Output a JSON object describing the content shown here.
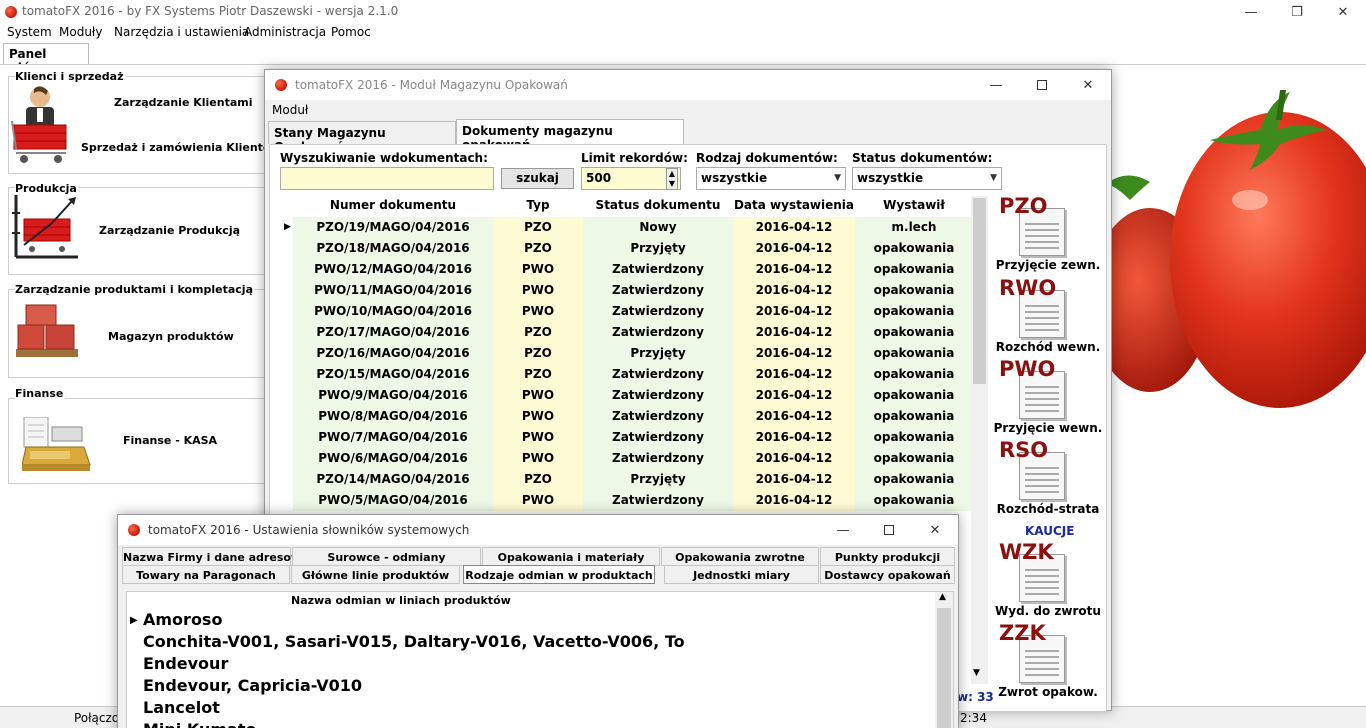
{
  "main_window": {
    "title": "tomatoFX 2016 - by FX Systems Piotr Daszewski - wersja 2.1.0",
    "menu": [
      "System",
      "Moduły",
      "Narzędzia i ustawienia",
      "Administracja",
      "Pomoc"
    ],
    "tab": "Panel główny",
    "controls": {
      "minimize": "—",
      "maximize": "❐",
      "close": "✕"
    }
  },
  "panel": {
    "groups": [
      {
        "label": "Klienci i sprzedaż",
        "links": [
          "Zarządzanie Klientami",
          "Sprzedaż i zamówienia Klientów"
        ]
      },
      {
        "label": "Produkcja",
        "links": [
          "Zarządzanie Produkcją"
        ]
      },
      {
        "label": "Zarządzanie produktami i kompletacją",
        "links": [
          "Magazyn produktów"
        ]
      },
      {
        "label": "Finanse",
        "links": [
          "Finanse - KASA"
        ]
      }
    ]
  },
  "status_bar": {
    "left": "Połączon",
    "right": "2:34"
  },
  "mag_window": {
    "title": "tomatoFX 2016 - Moduł Magazynu Opakowań",
    "menu": "Moduł",
    "tabs": [
      "Stany Magazynu Opakowań",
      "Dokumenty magazynu opakowań"
    ],
    "search_label": "Wyszukiwanie wdokumentach:",
    "search_value": "",
    "search_button": "szukaj",
    "limit_label": "Limit rekordów:",
    "limit_value": "500",
    "rodzaj_label": "Rodzaj dokumentów:",
    "rodzaj_value": "wszystkie",
    "status_label": "Status dokumentów:",
    "status_value": "wszystkie",
    "columns": [
      "Numer dokumentu",
      "Typ",
      "Status dokumentu",
      "Data wystawienia",
      "Wystawił"
    ],
    "rows": [
      [
        "PZO/19/MAGO/04/2016",
        "PZO",
        "Nowy",
        "2016-04-12",
        "m.lech"
      ],
      [
        "PZO/18/MAGO/04/2016",
        "PZO",
        "Przyjęty",
        "2016-04-12",
        "opakowania"
      ],
      [
        "PWO/12/MAGO/04/2016",
        "PWO",
        "Zatwierdzony",
        "2016-04-12",
        "opakowania"
      ],
      [
        "PWO/11/MAGO/04/2016",
        "PWO",
        "Zatwierdzony",
        "2016-04-12",
        "opakowania"
      ],
      [
        "PWO/10/MAGO/04/2016",
        "PWO",
        "Zatwierdzony",
        "2016-04-12",
        "opakowania"
      ],
      [
        "PZO/17/MAGO/04/2016",
        "PZO",
        "Zatwierdzony",
        "2016-04-12",
        "opakowania"
      ],
      [
        "PZO/16/MAGO/04/2016",
        "PZO",
        "Przyjęty",
        "2016-04-12",
        "opakowania"
      ],
      [
        "PZO/15/MAGO/04/2016",
        "PZO",
        "Zatwierdzony",
        "2016-04-12",
        "opakowania"
      ],
      [
        "PWO/9/MAGO/04/2016",
        "PWO",
        "Zatwierdzony",
        "2016-04-12",
        "opakowania"
      ],
      [
        "PWO/8/MAGO/04/2016",
        "PWO",
        "Zatwierdzony",
        "2016-04-12",
        "opakowania"
      ],
      [
        "PWO/7/MAGO/04/2016",
        "PWO",
        "Zatwierdzony",
        "2016-04-12",
        "opakowania"
      ],
      [
        "PWO/6/MAGO/04/2016",
        "PWO",
        "Zatwierdzony",
        "2016-04-12",
        "opakowania"
      ],
      [
        "PZO/14/MAGO/04/2016",
        "PZO",
        "Przyjęty",
        "2016-04-12",
        "opakowania"
      ],
      [
        "PWO/5/MAGO/04/2016",
        "PWO",
        "Zatwierdzony",
        "2016-04-12",
        "opakowania"
      ]
    ],
    "doc_buttons": [
      {
        "code": "PZO",
        "label": "Przyjęcie zewn."
      },
      {
        "code": "RWO",
        "label": "Rozchód wewn."
      },
      {
        "code": "PWO",
        "label": "Przyjęcie wewn."
      },
      {
        "code": "RSO",
        "label": "Rozchód-strata"
      },
      {
        "code": "WZK",
        "label": "Wyd. do zwrotu"
      },
      {
        "code": "ZZK",
        "label": "Zwrot opakow."
      }
    ],
    "kaucje_label": "KAUCJE",
    "count_text": "w: 33"
  },
  "slownik_window": {
    "title": "tomatoFX 2016 - Ustawienia słowników systemowych",
    "tabs_row1": [
      "Nazwa Firmy i dane adresowe",
      "Surowce - odmiany",
      "Opakowania i materiały",
      "Opakowania zwrotne",
      "Punkty produkcji"
    ],
    "tabs_row2": [
      "Towary na Paragonach",
      "Główne linie produktów",
      "Rodzaje odmian w produktach",
      "Jednostki miary",
      "Dostawcy opakowań"
    ],
    "column": "Nazwa odmian w liniach produktów",
    "rows": [
      "Amoroso",
      "Conchita-V001, Sasari-V015, Daltary-V016, Vacetto-V006, To",
      "Endevour",
      "Endevour, Capricia-V010",
      "Lancelot",
      "Mini Kumato"
    ]
  },
  "colors": {
    "doc_code": "#8b1010",
    "kaucje": "#1a2a9a",
    "grid_green": "#edf8e6",
    "grid_yellow": "#fdfbd4",
    "search_field": "#fdfbd0"
  }
}
